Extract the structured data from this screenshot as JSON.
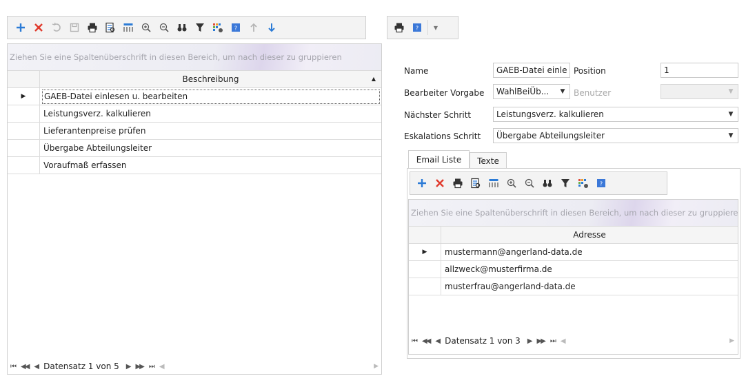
{
  "left_toolbar": {
    "icons": [
      "add-icon",
      "delete-icon",
      "undo-icon",
      "save-icon",
      "print-icon",
      "print-preview-icon",
      "column-chooser-icon",
      "zoom-in-icon",
      "zoom-out-icon",
      "find-icon",
      "filter-icon",
      "layout-settings-icon",
      "help-icon",
      "move-up-icon",
      "move-down-icon"
    ]
  },
  "left_grid": {
    "group_panel": "Ziehen Sie eine Spaltenüberschrift in diesen Bereich, um nach dieser zu gruppieren",
    "column_header": "Beschreibung",
    "rows": [
      "GAEB-Datei einlesen u. bearbeiten",
      "Leistungsverz. kalkulieren",
      "Lieferantenpreise prüfen",
      "Übergabe Abteilungsleiter",
      "Voraufmaß erfassen"
    ],
    "selected_row": 0,
    "navigator": "Datensatz 1 von 5"
  },
  "right_toolbar": {
    "icons": [
      "print-icon",
      "help-icon",
      "dropdown-arrow-icon"
    ]
  },
  "form": {
    "name_label": "Name",
    "name_value": "GAEB-Datei einle",
    "position_label": "Position",
    "position_value": "1",
    "bearbeiter_label": "Bearbeiter Vorgabe",
    "bearbeiter_value": "WahlBeiÜb...",
    "benutzer_label": "Benutzer",
    "benutzer_value": "",
    "naechster_label": "Nächster Schritt",
    "naechster_value": "Leistungsverz. kalkulieren",
    "eskalation_label": "Eskalations Schritt",
    "eskalation_value": "Übergabe Abteilungsleiter"
  },
  "tabs": [
    "Email Liste",
    "Texte"
  ],
  "active_tab": 0,
  "email_toolbar": {
    "icons": [
      "add-icon",
      "delete-icon",
      "print-icon",
      "print-preview-icon",
      "column-chooser-icon",
      "zoom-in-icon",
      "zoom-out-icon",
      "find-icon",
      "filter-icon",
      "layout-settings-icon",
      "help-icon"
    ]
  },
  "email_grid": {
    "group_panel": "Ziehen Sie eine Spaltenüberschrift in diesen Bereich, um nach dieser zu gruppieren",
    "column_header": "Adresse",
    "rows": [
      "mustermann@angerland-data.de",
      "allzweck@musterfirma.de",
      "musterfrau@angerland-data.de"
    ],
    "selected_row": 0,
    "navigator": "Datensatz 1 von 3"
  },
  "colors": {
    "accent_blue": "#2b7bd6",
    "delete_red": "#e0392b",
    "disabled_gray": "#b5b5b5"
  }
}
